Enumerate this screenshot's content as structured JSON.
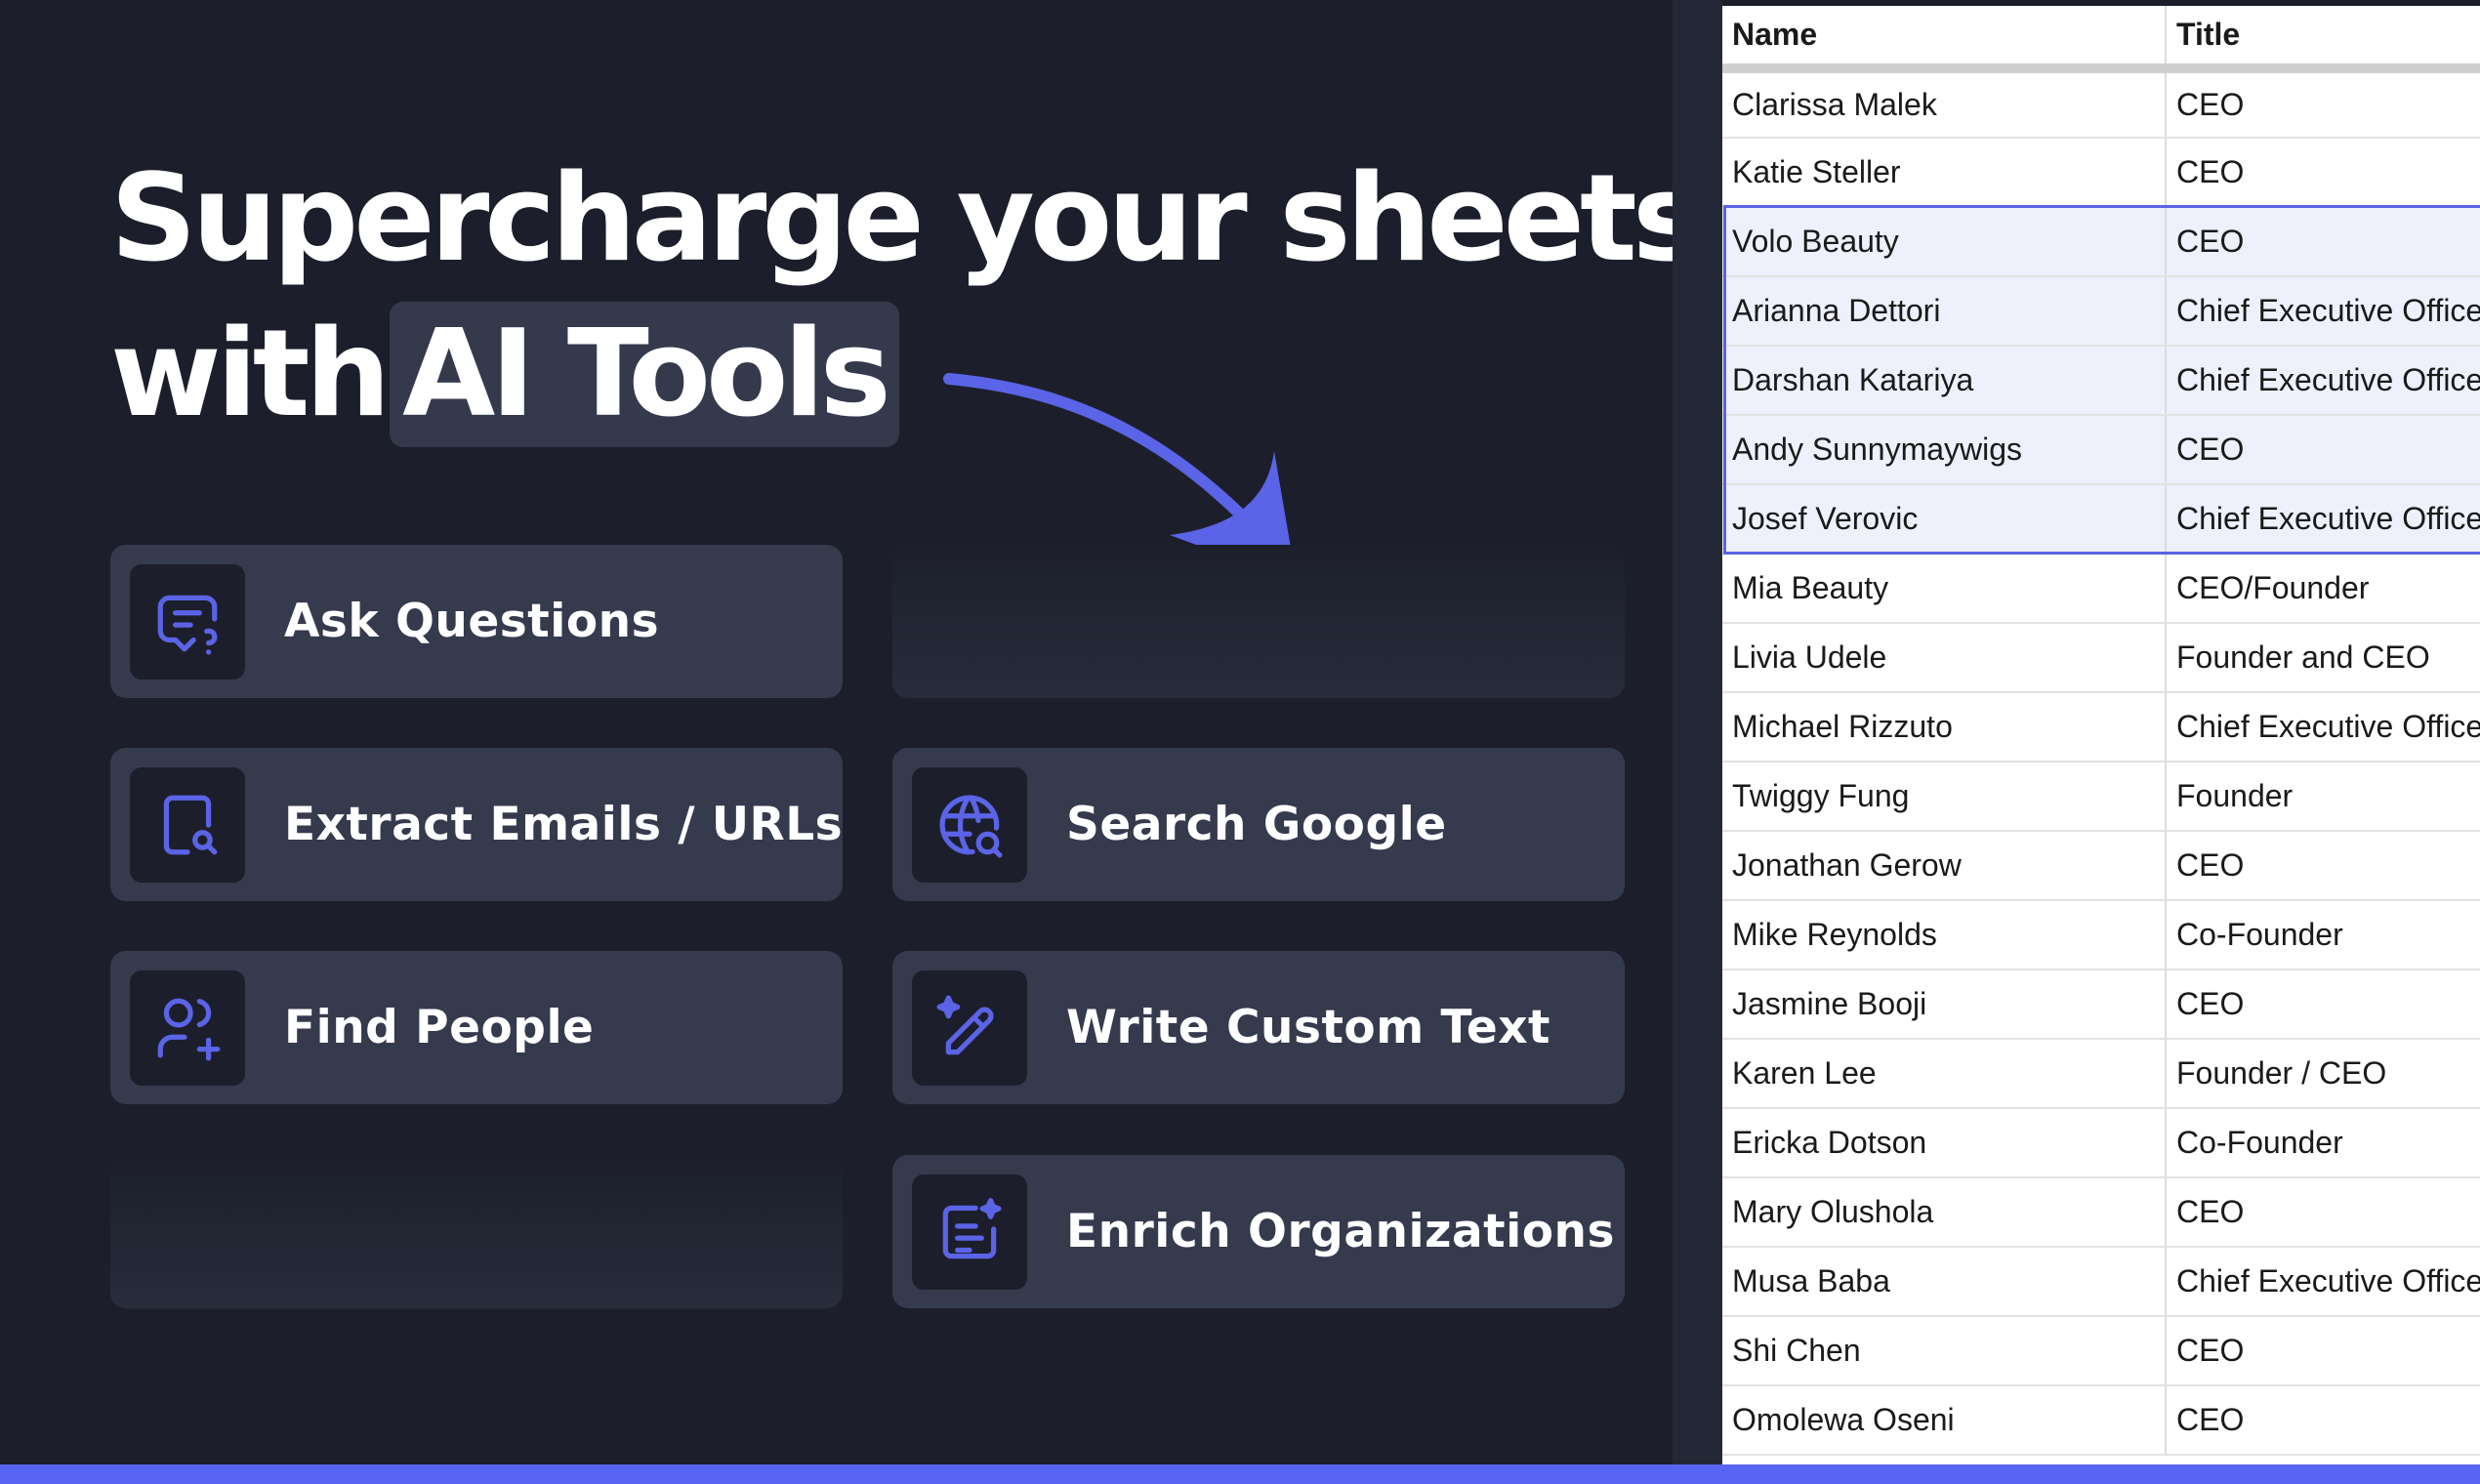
{
  "headline": {
    "line1": "Supercharge your sheets",
    "line2_prefix": "with",
    "line2_highlight": "AI Tools"
  },
  "features": [
    {
      "label": "Ask Questions",
      "icon": "chat-question-icon"
    },
    {
      "label": "Extract Emails / URLs",
      "icon": "document-search-icon"
    },
    {
      "label": "Search Google",
      "icon": "globe-search-icon"
    },
    {
      "label": "Find People",
      "icon": "users-add-icon"
    },
    {
      "label": "Write Custom Text",
      "icon": "sparkle-pen-icon"
    },
    {
      "label": "Enrich Organizations",
      "icon": "sparkle-document-icon"
    }
  ],
  "sheet": {
    "headers": [
      "Name",
      "Title"
    ],
    "rows": [
      [
        "Clarissa Malek",
        "CEO"
      ],
      [
        "Katie Steller",
        "CEO"
      ],
      [
        "Volo Beauty",
        "CEO"
      ],
      [
        "Arianna Dettori",
        "Chief Executive Officer"
      ],
      [
        "Darshan Katariya",
        "Chief Executive Officer"
      ],
      [
        "Andy Sunnymaywigs",
        "CEO"
      ],
      [
        "Josef Verovic",
        "Chief Executive Officer"
      ],
      [
        "Mia Beauty",
        "CEO/Founder"
      ],
      [
        "Livia Udele",
        "Founder and CEO"
      ],
      [
        "Michael Rizzuto",
        "Chief Executive Officer"
      ],
      [
        "Twiggy Fung",
        "Founder"
      ],
      [
        "Jonathan Gerow",
        "CEO"
      ],
      [
        "Mike Reynolds",
        "Co-Founder"
      ],
      [
        "Jasmine Booji",
        "CEO"
      ],
      [
        "Karen Lee",
        "Founder / CEO"
      ],
      [
        "Ericka Dotson",
        "Co-Founder"
      ],
      [
        "Mary Olushola",
        "CEO"
      ],
      [
        "Musa Baba",
        "Chief Executive Officer"
      ],
      [
        "Shi Chen",
        "CEO"
      ],
      [
        "Omolewa Oseni",
        "CEO"
      ]
    ],
    "selected_rows": [
      2,
      3,
      4,
      5,
      6
    ]
  },
  "colors": {
    "accent": "#5865f2",
    "background": "#1c1f2b",
    "card": "#353a4d",
    "icon": "#5b63e6"
  }
}
